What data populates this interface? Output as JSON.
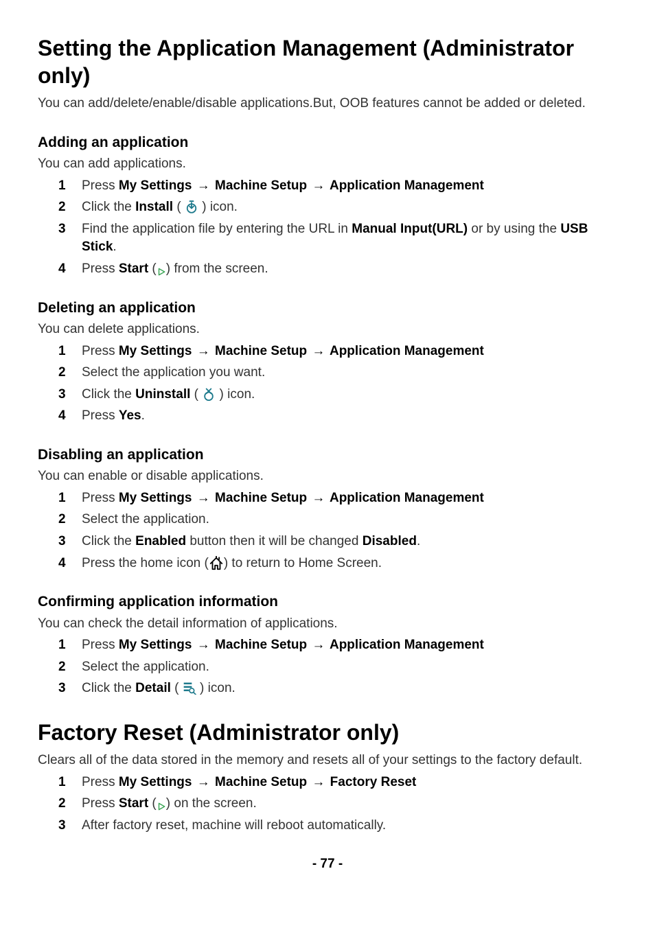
{
  "page_number": "- 77 -",
  "arrow": "→",
  "h1_app_mgmt": "Setting the Application Management (Administrator only)",
  "p_app_mgmt": "You can add/delete/enable/disable applications.But, OOB features cannot be added or deleted.",
  "adding": {
    "title": "Adding an application",
    "intro": "You can add applications.",
    "s1_a": "Press ",
    "s1_b": "My Settings",
    "s1_c": " Machine Setup ",
    "s1_d": " Application Management",
    "s2_a": "Click the ",
    "s2_b": "Install",
    "s2_c": " ( ",
    "s2_d": " ) icon.",
    "s3_a": "Find the application file by entering the URL in ",
    "s3_b": "Manual Input(URL)",
    "s3_c": " or by using the ",
    "s3_d": "USB Stick",
    "s3_e": ".",
    "s4_a": "Press ",
    "s4_b": "Start",
    "s4_c": " (",
    "s4_d": ") from the screen."
  },
  "deleting": {
    "title": "Deleting an application",
    "intro": "You can delete applications.",
    "s1_a": "Press ",
    "s1_b": "My Settings",
    "s1_c": " Machine Setup ",
    "s1_d": " Application Management",
    "s2": "Select the application you want.",
    "s3_a": "Click the ",
    "s3_b": "Uninstall",
    "s3_c": " ( ",
    "s3_d": " ) icon.",
    "s4_a": "Press ",
    "s4_b": "Yes",
    "s4_c": "."
  },
  "disabling": {
    "title": "Disabling an application",
    "intro": "You can enable or disable applications.",
    "s1_a": "Press ",
    "s1_b": "My Settings",
    "s1_c": " Machine Setup ",
    "s1_d": " Application Management",
    "s2": "Select the application.",
    "s3_a": "Click the ",
    "s3_b": "Enabled",
    "s3_c": " button then it will be changed ",
    "s3_d": "Disabled",
    "s3_e": ".",
    "s4_a": "Press the home icon (",
    "s4_b": ") to return to Home Screen."
  },
  "confirming": {
    "title": "Confirming application information",
    "intro": "You can check the detail information of applications.",
    "s1_a": "Press ",
    "s1_b": "My Settings",
    "s1_c": " Machine Setup ",
    "s1_d": " Application Management",
    "s2": "Select the application.",
    "s3_a": "Click the ",
    "s3_b": "Detail",
    "s3_c": " ( ",
    "s3_d": " ) icon."
  },
  "h1_factory": "Factory Reset (Administrator only)",
  "p_factory": "Clears all of the data stored in the memory and resets all of your settings to the factory default.",
  "factory": {
    "s1_a": "Press ",
    "s1_b": "My Settings",
    "s1_c": " Machine Setup ",
    "s1_d": " Factory Reset",
    "s2_a": "Press ",
    "s2_b": "Start",
    "s2_c": " (",
    "s2_d": ") on the screen.",
    "s3": "After factory reset, machine will reboot automatically."
  }
}
